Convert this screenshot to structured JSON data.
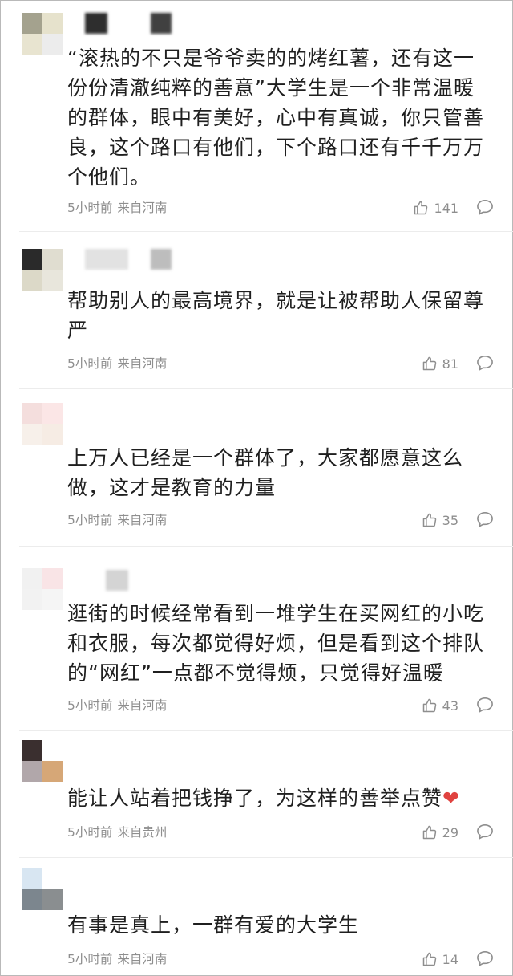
{
  "comments": [
    {
      "text": "“滚热的不只是爷爷卖的的烤红薯，还有这一份份清澈纯粹的善意”大学生是一个非常温暖的群体，眼中有美好，心中有真诚，你只管善良，这个路口有他们，下个路口还有千千万万个他们。",
      "time": "5小时前",
      "location": "来自河南",
      "likes": "141",
      "avatar_colors": [
        "#a4a28e",
        "#e6e2cc",
        "#e8e4d0",
        "#d9d9d9"
      ]
    },
    {
      "text": "帮助别人的最高境界，就是让被帮助人保留尊严",
      "time": "5小时前",
      "location": "来自河南",
      "likes": "81",
      "avatar_colors": [
        "#2a2a2a",
        "#e0ddd0",
        "#dcd9c8",
        "#e8e6dc"
      ]
    },
    {
      "text": "上万人已经是一个群体了，大家都愿意这么做，这才是教育的力量",
      "time": "5小时前",
      "location": "来自河南",
      "likes": "35",
      "avatar_colors": [
        "#f4dedd",
        "#fbe6e6",
        "#f7f0ea",
        "#f6ece4"
      ]
    },
    {
      "text": "逛街的时候经常看到一堆学生在买网红的小吃和衣服，每次都觉得好烦，但是看到这个排队的“网红”一点都不觉得烦，只觉得好温暖",
      "time": "5小时前",
      "location": "来自河南",
      "likes": "43",
      "avatar_colors": [
        "#f1f1f1",
        "#f9e4e6",
        "#f2f2f2",
        "#f5f5f5"
      ]
    },
    {
      "text": "能让人站着把钱挣了，为这样的善举点赞",
      "heart": "❤",
      "time": "5小时前",
      "location": "来自贵州",
      "likes": "29",
      "avatar_colors": [
        "#3a2f2f",
        "#ffffff",
        "#b1a7aa",
        "#d6a777"
      ]
    },
    {
      "text": "有事是真上，一群有爱的大学生",
      "time": "5小时前",
      "location": "来自河南",
      "likes": "14",
      "avatar_colors": [
        "#d8e6f2",
        "#ffffff",
        "#7c868e",
        "#8a8e90"
      ]
    }
  ],
  "icons": {
    "like": "thumbs-up-icon",
    "reply": "comment-bubble-icon"
  },
  "colors": {
    "text": "#1f1f1f",
    "meta": "#8e8e8e",
    "heart": "#e0423f"
  }
}
